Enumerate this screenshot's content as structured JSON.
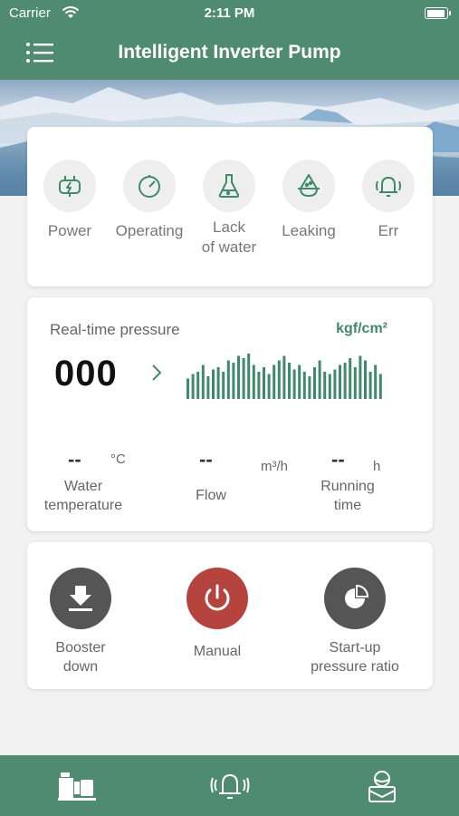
{
  "status_bar": {
    "carrier": "Carrier",
    "time": "2:11 PM"
  },
  "nav": {
    "title": "Intelligent Inverter Pump",
    "menu_icon": "hamburger-menu-icon"
  },
  "status_indicators": [
    {
      "label": "Power",
      "icon": "power-plug-icon"
    },
    {
      "label": "Operating",
      "icon": "gauge-icon"
    },
    {
      "label": "Lack\nof water",
      "icon": "flask-icon"
    },
    {
      "label": "Leaking",
      "icon": "water-drop-icon"
    },
    {
      "label": "Err",
      "icon": "alarm-bell-icon"
    }
  ],
  "pressure": {
    "label": "Real-time pressure",
    "unit": "kgf/cm²",
    "value": "000",
    "bar_levels": [
      0.45,
      0.55,
      0.6,
      0.75,
      0.5,
      0.65,
      0.7,
      0.6,
      0.85,
      0.8,
      0.95,
      0.9,
      1.0,
      0.75,
      0.6,
      0.7,
      0.55,
      0.75,
      0.85,
      0.95,
      0.8,
      0.65,
      0.75,
      0.6,
      0.5,
      0.7,
      0.85,
      0.6,
      0.55,
      0.65,
      0.75,
      0.8,
      0.9,
      0.7,
      0.95,
      0.85,
      0.6,
      0.75,
      0.55
    ]
  },
  "metrics": {
    "water_temp": {
      "value": "--",
      "unit": "°C",
      "label": "Water\ntemperature"
    },
    "flow": {
      "value": "--",
      "unit": "m³/h",
      "label": "Flow"
    },
    "running_time": {
      "value": "--",
      "unit": "h",
      "label": "Running\ntime"
    }
  },
  "actions": [
    {
      "label": "Booster\ndown",
      "icon": "download-icon",
      "color": "#555555"
    },
    {
      "label": "Manual",
      "icon": "power-button-icon",
      "color": "#b5443f"
    },
    {
      "label": "Start-up\npressure ratio",
      "icon": "pie-chart-icon",
      "color": "#555555"
    }
  ],
  "tabs": [
    {
      "icon": "pump-icon"
    },
    {
      "icon": "alarm-bell-icon"
    },
    {
      "icon": "user-profile-icon"
    }
  ],
  "colors": {
    "primary": "#4e8b70",
    "accent_green": "#3f8a6a",
    "manual_red": "#b5443f",
    "action_gray": "#555555"
  }
}
